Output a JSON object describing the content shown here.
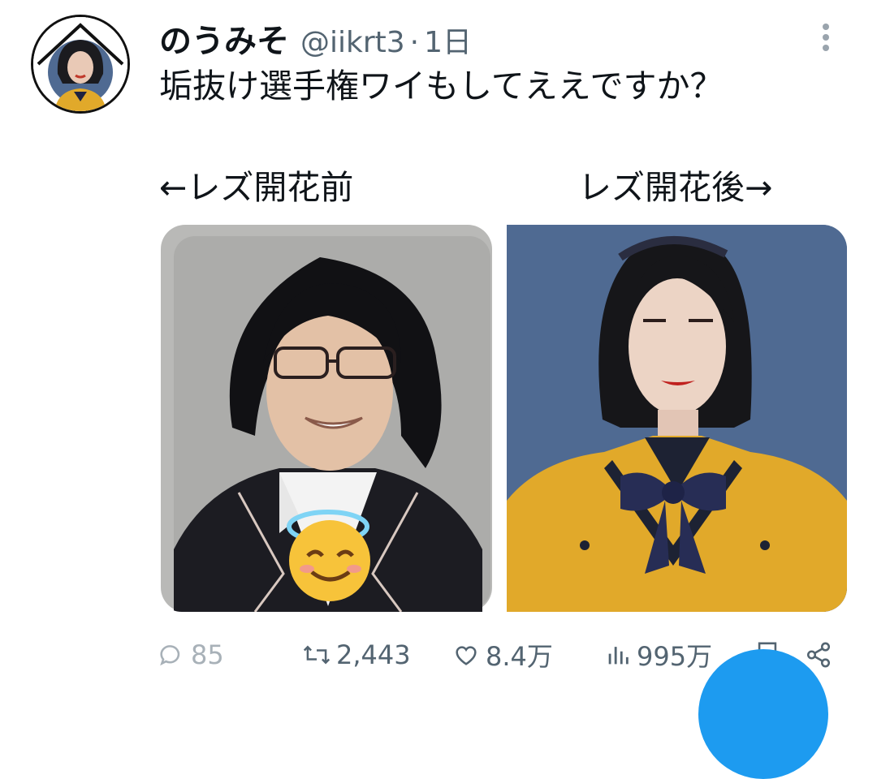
{
  "tweet": {
    "display_name": "のうみそ",
    "handle": "@iikrt3",
    "separator": "·",
    "time": "1日",
    "text": "垢抜け選手権ワイもしてええですか？"
  },
  "image_captions": {
    "left": "←レズ開花前",
    "right": "レズ開花後→"
  },
  "actions": {
    "replies": "85",
    "retweets": "2,443",
    "likes": "8.4万",
    "views": "995万"
  },
  "colors": {
    "text_primary": "#0f1419",
    "text_secondary": "#536471",
    "accent": "#1d9bf0"
  },
  "icons": [
    "more-vertical-icon",
    "reply-icon",
    "retweet-icon",
    "like-icon",
    "views-icon",
    "bookmark-icon",
    "share-icon"
  ]
}
